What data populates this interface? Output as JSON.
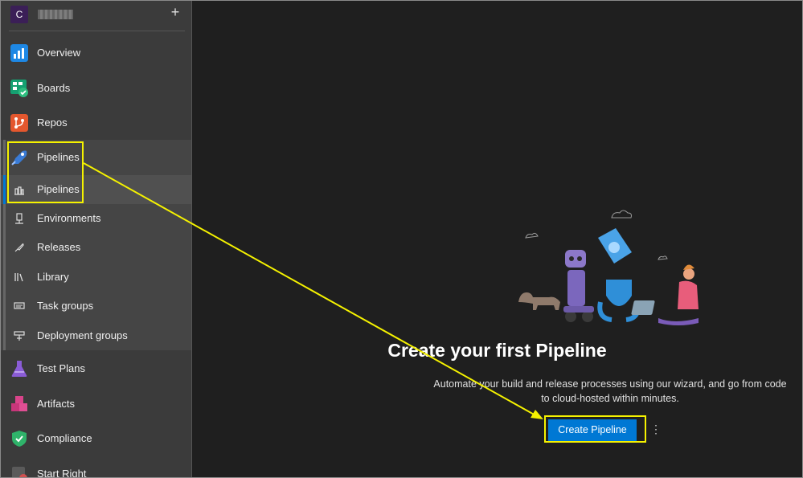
{
  "org": {
    "initial": "C",
    "add_label": "+"
  },
  "nav": {
    "overview": "Overview",
    "boards": "Boards",
    "repos": "Repos",
    "pipelines": "Pipelines",
    "pipelines_sub": [
      {
        "label": "Pipelines",
        "icon": "pipelines-list-icon"
      },
      {
        "label": "Environments",
        "icon": "environments-icon"
      },
      {
        "label": "Releases",
        "icon": "releases-icon"
      },
      {
        "label": "Library",
        "icon": "library-icon"
      },
      {
        "label": "Task groups",
        "icon": "task-groups-icon"
      },
      {
        "label": "Deployment groups",
        "icon": "deployment-groups-icon"
      }
    ],
    "test_plans": "Test Plans",
    "artifacts": "Artifacts",
    "compliance": "Compliance",
    "start_right": "Start Right"
  },
  "main": {
    "title": "Create your first Pipeline",
    "description": "Automate your build and release processes using our wizard, and go from code to cloud-hosted within minutes.",
    "create_button": "Create Pipeline",
    "more_label": "⋮"
  },
  "colors": {
    "accent": "#0078d4",
    "highlight": "#f5f200",
    "sidebar_bg": "#3b3b3b",
    "main_bg": "#1f1f1f"
  }
}
